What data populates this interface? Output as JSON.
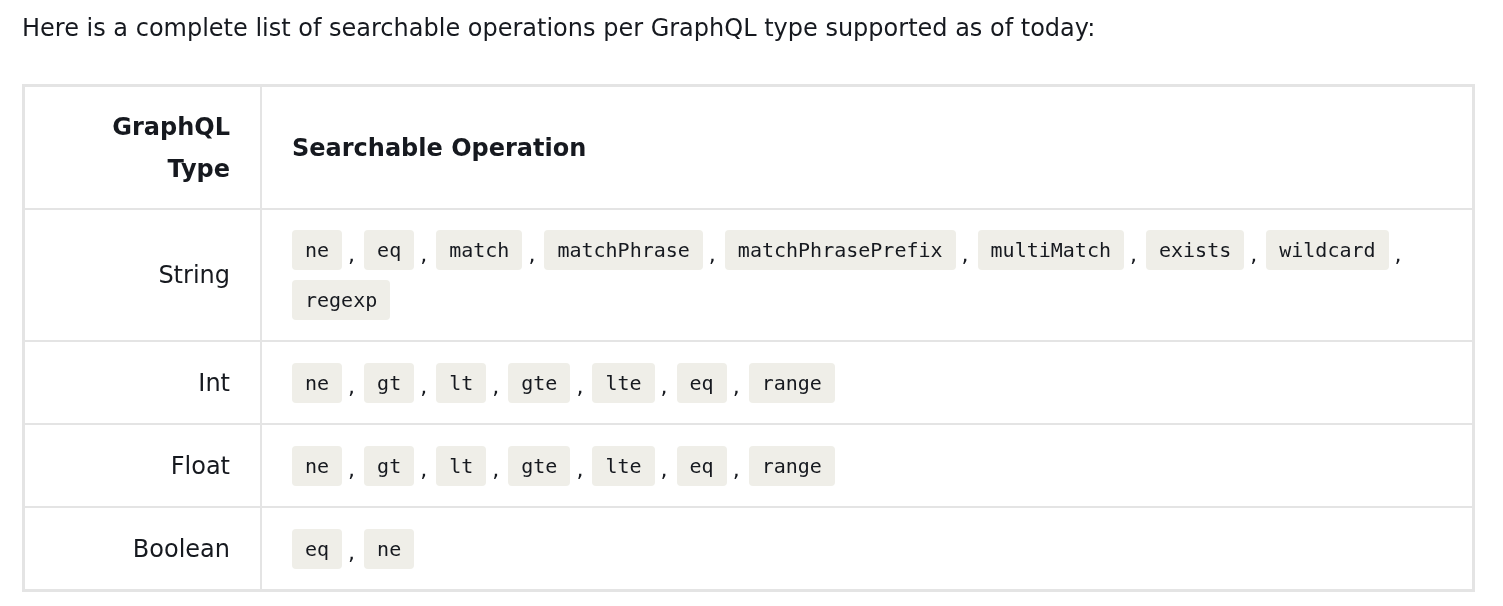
{
  "intro": "Here is a complete list of searchable operations per GraphQL type supported as of today:",
  "table": {
    "columns": [
      "GraphQL Type",
      "Searchable Operation"
    ],
    "rows": [
      {
        "type": "String",
        "operations": [
          {
            "code": "ne",
            "after": ","
          },
          {
            "code": "eq",
            "after": ","
          },
          {
            "code": "match",
            "after": ","
          },
          {
            "code": "matchPhrase",
            "after": ","
          },
          {
            "code": "matchPhrasePrefix",
            "after": ","
          },
          {
            "code": "multiMatch",
            "after": ","
          },
          {
            "code": "exists",
            "after": ","
          },
          {
            "code": "wildcard",
            "after": ","
          },
          {
            "code": "regexp"
          }
        ]
      },
      {
        "type": "Int",
        "operations": [
          {
            "code": "ne",
            "after": ","
          },
          {
            "code": "gt",
            "after": ","
          },
          {
            "code": "lt",
            "after": ","
          },
          {
            "code": "gte",
            "after": ","
          },
          {
            "code": "lte",
            "after": ","
          },
          {
            "code": "eq",
            "after": ","
          },
          {
            "code": "range"
          }
        ]
      },
      {
        "type": "Float",
        "operations": [
          {
            "code": "ne",
            "after": ","
          },
          {
            "code": "gt",
            "after": ","
          },
          {
            "code": "lt",
            "after": ","
          },
          {
            "code": "gte",
            "after": ","
          },
          {
            "code": "lte",
            "after": ","
          },
          {
            "code": "eq",
            "after": ","
          },
          {
            "code": "range"
          }
        ]
      },
      {
        "type": "Boolean",
        "operations": [
          {
            "code": "eq",
            "after": ","
          },
          {
            "code": "ne"
          }
        ]
      }
    ]
  }
}
